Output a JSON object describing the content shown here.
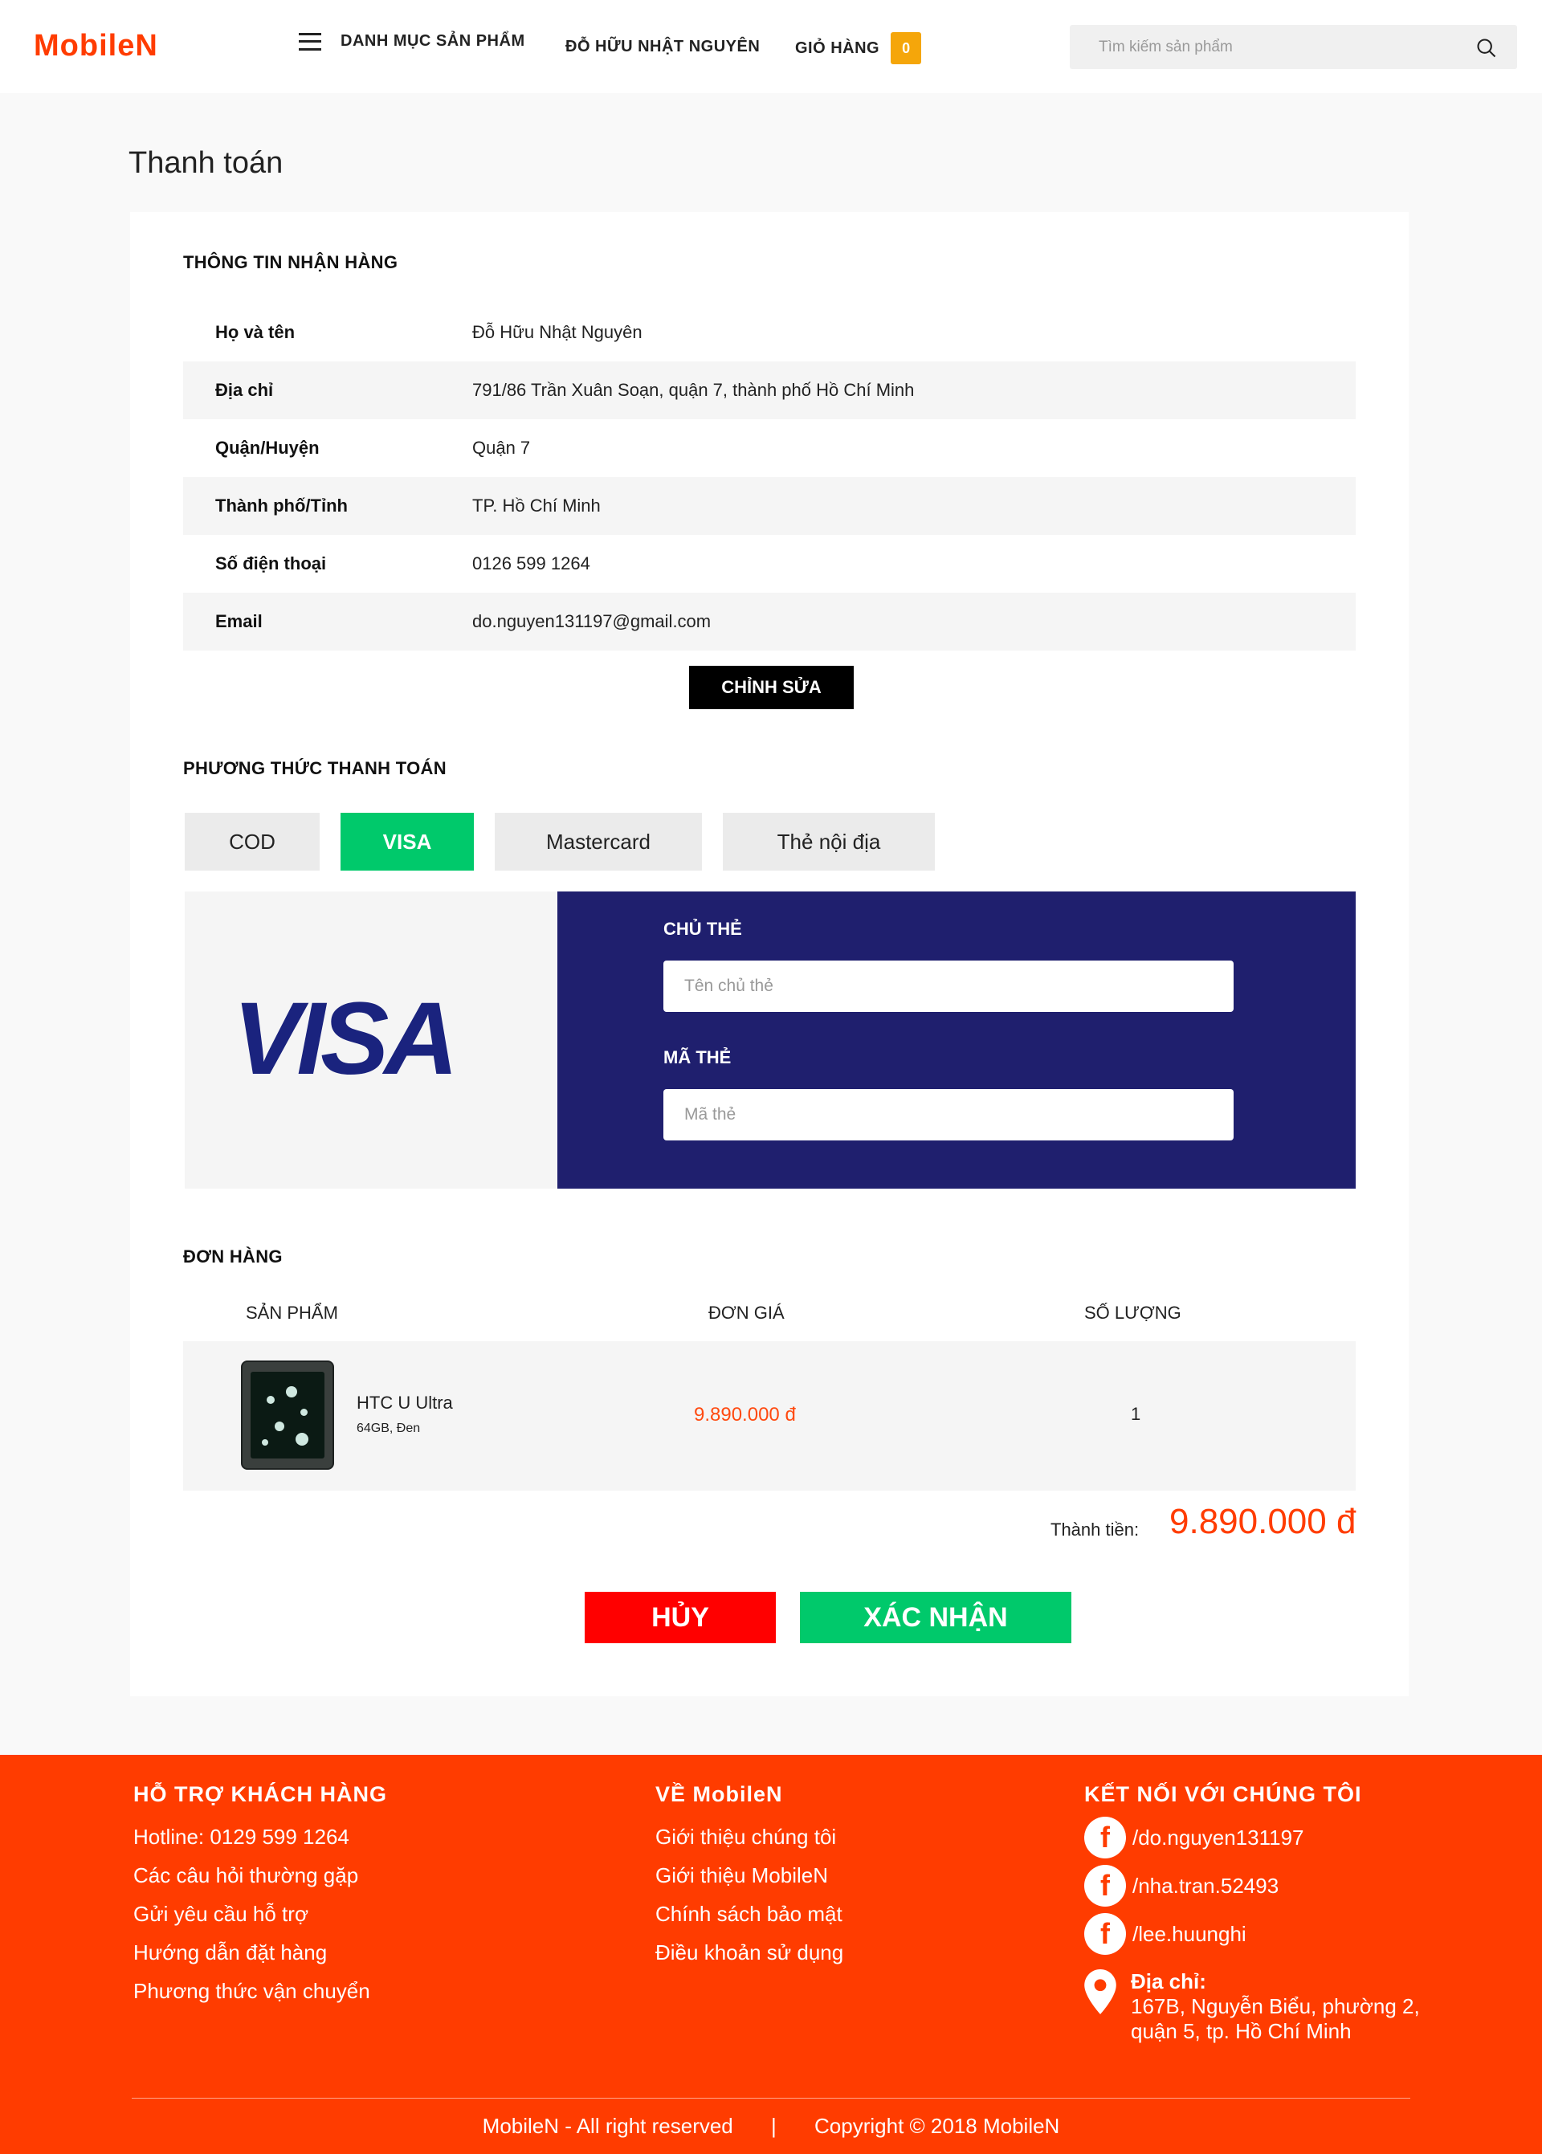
{
  "header": {
    "logo": "MobileN",
    "menu_label": "DANH MỤC SẢN PHẨM",
    "user_name": "ĐỖ HỮU NHẬT NGUYÊN",
    "cart_label": "GIỎ HÀNG",
    "cart_count": "0",
    "search_placeholder": "Tìm kiếm sản phẩm"
  },
  "page_title": "Thanh toán",
  "shipping": {
    "title": "THÔNG TIN NHẬN HÀNG",
    "rows": [
      {
        "label": "Họ và tên",
        "value": "Đỗ Hữu Nhật Nguyên"
      },
      {
        "label": "Địa chỉ",
        "value": "791/86 Trần Xuân Soạn, quận 7, thành phố Hồ Chí Minh"
      },
      {
        "label": "Quận/Huyện",
        "value": "Quận 7"
      },
      {
        "label": "Thành phố/Tỉnh",
        "value": "TP. Hồ Chí Minh"
      },
      {
        "label": "Số điện thoại",
        "value": "0126 599 1264"
      },
      {
        "label": "Email",
        "value": "do.nguyen131197@gmail.com"
      }
    ],
    "edit_button": "CHỈNH SỬA"
  },
  "payment": {
    "title": "PHƯƠNG THỨC THANH TOÁN",
    "tabs": [
      {
        "label": "COD",
        "active": false
      },
      {
        "label": "VISA",
        "active": true
      },
      {
        "label": "Mastercard",
        "active": false
      },
      {
        "label": "Thẻ nội địa",
        "active": false
      }
    ],
    "visa_logo_text": "VISA",
    "cardholder_label": "CHỦ THẺ",
    "cardholder_placeholder": "Tên chủ thẻ",
    "card_number_label": "MÃ THẺ",
    "card_number_placeholder": "Mã thẻ"
  },
  "order": {
    "title": "ĐƠN HÀNG",
    "columns": [
      "SẢN PHẨM",
      "ĐƠN GIÁ",
      "SỐ LƯỢNG"
    ],
    "items": [
      {
        "name": "HTC U Ultra",
        "variant": "64GB, Đen",
        "price": "9.890.000 đ",
        "quantity": "1"
      }
    ],
    "total_label": "Thành tiền:",
    "total_value": "9.890.000 đ",
    "cancel_button": "HỦY",
    "confirm_button": "XÁC NHẬN"
  },
  "footer": {
    "support": {
      "title": "HỖ TRỢ KHÁCH HÀNG",
      "links": [
        "Hotline: 0129 599 1264",
        "Các câu hỏi thường gặp",
        "Gửi yêu cầu hỗ trợ",
        "Hướng dẫn đặt hàng",
        "Phương thức vận chuyển"
      ]
    },
    "about": {
      "title": "VỀ MobileN",
      "links": [
        "Giới thiệu chúng tôi",
        "Giới thiệu MobileN",
        "Chính sách bảo mật",
        "Điều khoản sử dụng"
      ]
    },
    "connect": {
      "title": "KẾT NỐI VỚI CHÚNG TÔI",
      "socials": [
        "/do.nguyen131197",
        "/nha.tran.52493",
        "/lee.huunghi"
      ],
      "address_label": "Địa chỉ:",
      "address_line1": "167B, Nguyễn Biểu, phường 2,",
      "address_line2": "quận 5, tp. Hồ Chí Minh"
    },
    "rights": "MobileN - All right reserved",
    "separator": "|",
    "copyright": "Copyright © 2018 MobileN"
  },
  "colors": {
    "brand": "#ff3c00",
    "success": "#00c96b",
    "danger": "#ff0000",
    "visa_panel": "#1f1f6e",
    "cart_badge": "#f5a60a"
  }
}
